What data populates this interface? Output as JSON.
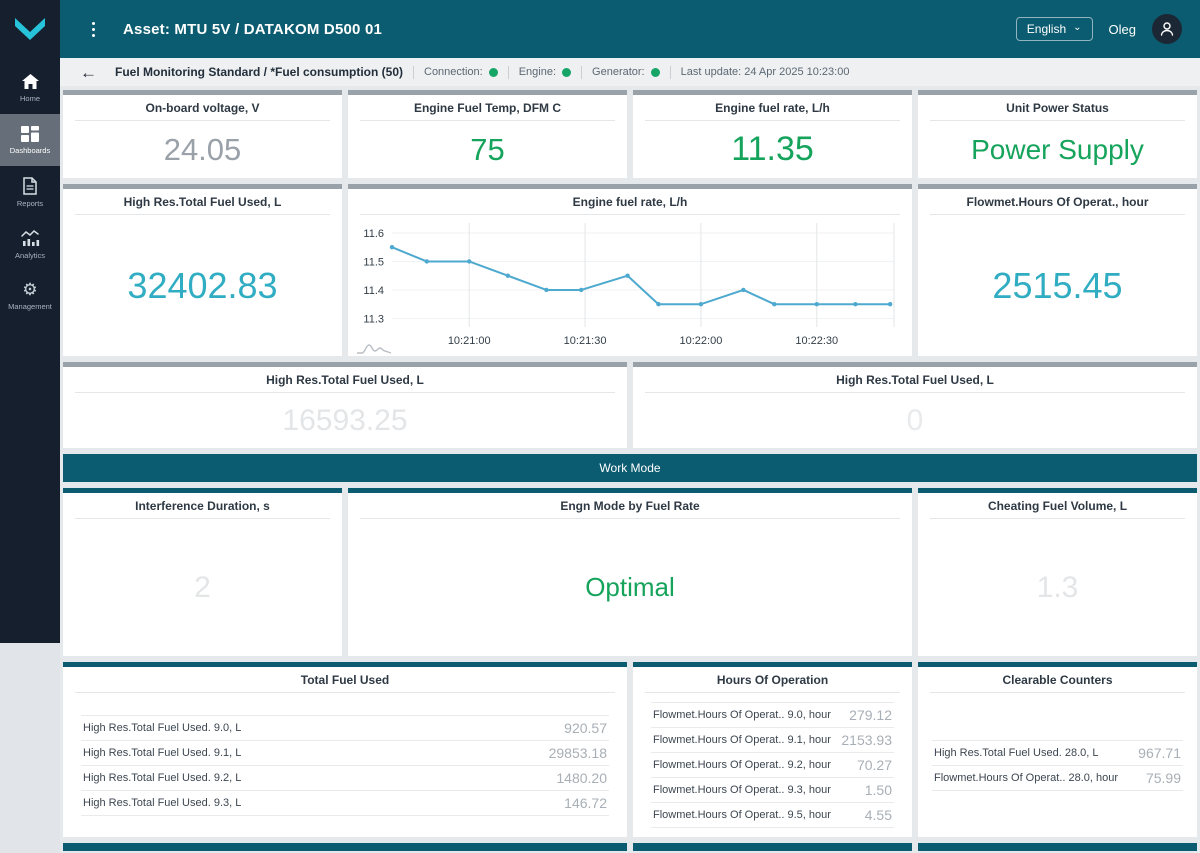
{
  "topbar": {
    "title": "Asset: MTU 5V / DATAKOM D500 01",
    "language": "English",
    "user": "Oleg"
  },
  "sidebar": {
    "items": [
      {
        "label": "Home"
      },
      {
        "label": "Dashboards"
      },
      {
        "label": "Reports"
      },
      {
        "label": "Analytics"
      },
      {
        "label": "Management"
      }
    ]
  },
  "subheader": {
    "breadcrumb": "Fuel Monitoring Standard / *Fuel consumption (50)",
    "statuses": [
      {
        "label": "Connection:"
      },
      {
        "label": "Engine:"
      },
      {
        "label": "Generator:"
      }
    ],
    "last_update": "Last update: 24 Apr 2025 10:23:00"
  },
  "cards": {
    "row1": [
      {
        "title": "On-board voltage, V",
        "value": "24.05"
      },
      {
        "title": "Engine Fuel Temp, DFM C",
        "value": "75"
      },
      {
        "title": "Engine fuel rate, L/h",
        "value": "11.35"
      },
      {
        "title": "Unit Power Status",
        "value": "Power Supply"
      }
    ],
    "row2_left": {
      "title": "High Res.Total Fuel Used, L",
      "value": "32402.83"
    },
    "row2_chart_title": "Engine fuel rate, L/h",
    "row2_right": {
      "title": "Flowmet.Hours Of Operat., hour",
      "value": "2515.45"
    },
    "row3": [
      {
        "title": "High Res.Total Fuel Used, L",
        "value": "16593.25"
      },
      {
        "title": "High Res.Total Fuel Used, L",
        "value": "0"
      }
    ],
    "work_mode_label": "Work Mode",
    "row4": [
      {
        "title": "Interference Duration, s",
        "value": "2"
      },
      {
        "title": "Engn Mode by Fuel Rate",
        "value": "Optimal"
      },
      {
        "title": "Cheating Fuel Volume, L",
        "value": "1.3"
      }
    ]
  },
  "tables": [
    {
      "title": "Total Fuel Used",
      "rows": [
        {
          "label": "High Res.Total Fuel Used. 9.0, L",
          "value": "920.57"
        },
        {
          "label": "High Res.Total Fuel Used. 9.1, L",
          "value": "29853.18"
        },
        {
          "label": "High Res.Total Fuel Used. 9.2, L",
          "value": "1480.20"
        },
        {
          "label": "High Res.Total Fuel Used. 9.3, L",
          "value": "146.72"
        }
      ]
    },
    {
      "title": "Hours Of Operation",
      "rows": [
        {
          "label": "Flowmet.Hours Of Operat.. 9.0, hour",
          "value": "279.12"
        },
        {
          "label": "Flowmet.Hours Of Operat.. 9.1, hour",
          "value": "2153.93"
        },
        {
          "label": "Flowmet.Hours Of Operat.. 9.2, hour",
          "value": "70.27"
        },
        {
          "label": "Flowmet.Hours Of Operat.. 9.3, hour",
          "value": "1.50"
        },
        {
          "label": "Flowmet.Hours Of Operat.. 9.5, hour",
          "value": "4.55"
        }
      ]
    },
    {
      "title": "Clearable Counters",
      "rows": [
        {
          "label": "High Res.Total Fuel Used. 28.0, L",
          "value": "967.71"
        },
        {
          "label": "Flowmet.Hours Of Operat.. 28.0, hour",
          "value": "75.99"
        }
      ]
    }
  ],
  "chart_data": {
    "type": "line",
    "title": "Engine fuel rate, L/h",
    "xlabel": "",
    "ylabel": "",
    "x_range_seconds": [
      0,
      130
    ],
    "ylim": [
      11.27,
      11.635
    ],
    "y_ticks": [
      11.3,
      11.4,
      11.5,
      11.6
    ],
    "x_ticks": [
      {
        "offset": 20,
        "label": "10:21:00"
      },
      {
        "offset": 50,
        "label": "10:21:30"
      },
      {
        "offset": 80,
        "label": "10:22:00"
      },
      {
        "offset": 110,
        "label": "10:22:30"
      }
    ],
    "grid": true,
    "legend": false,
    "line_color": "#4ea9cf",
    "points": [
      {
        "t": 0,
        "v": 11.55
      },
      {
        "t": 9,
        "v": 11.5
      },
      {
        "t": 20,
        "v": 11.5
      },
      {
        "t": 30,
        "v": 11.45
      },
      {
        "t": 40,
        "v": 11.4
      },
      {
        "t": 49,
        "v": 11.4
      },
      {
        "t": 61,
        "v": 11.45
      },
      {
        "t": 69,
        "v": 11.35
      },
      {
        "t": 80,
        "v": 11.35
      },
      {
        "t": 91,
        "v": 11.4
      },
      {
        "t": 99,
        "v": 11.35
      },
      {
        "t": 110,
        "v": 11.35
      },
      {
        "t": 120,
        "v": 11.35
      },
      {
        "t": 129,
        "v": 11.35
      }
    ]
  },
  "colors": {
    "topbar_teal": "#0b5c70",
    "sidebar_navy": "#161f2d",
    "logo_cyan": "#27c3da",
    "value_green": "#16a45c",
    "value_teal": "#30adc2",
    "status_green": "#17a567",
    "chart_line": "#4ea9cf"
  }
}
